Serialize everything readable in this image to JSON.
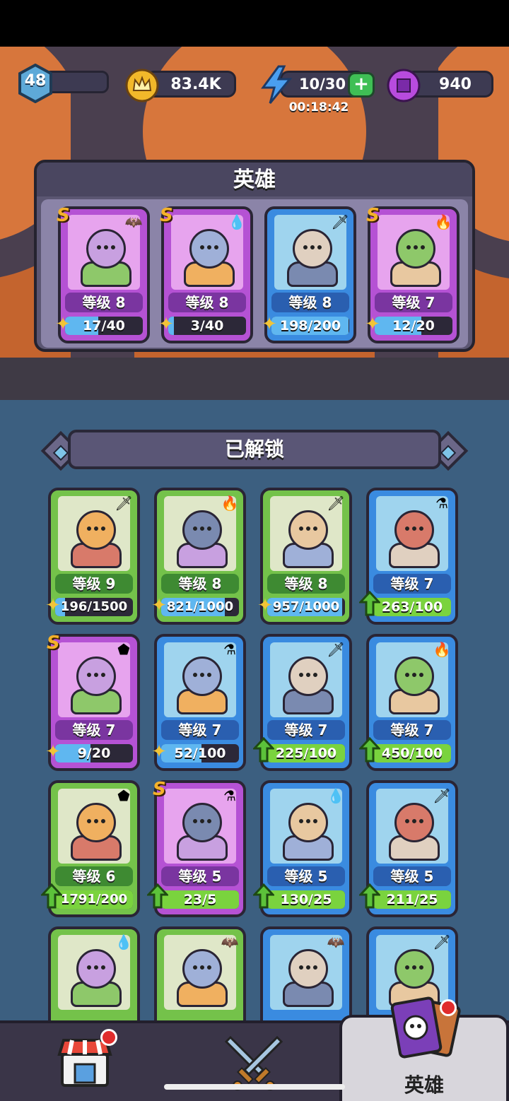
{
  "topbar": {
    "player_level": "48",
    "coins": "83.4K",
    "energy": "10/30",
    "energy_timer": "00:18:42",
    "gems": "940",
    "xp_progress": 0.07
  },
  "hero_panel": {
    "title": "英雄",
    "cards": [
      {
        "rank": "S",
        "element": "bat",
        "level": "等级 8",
        "progress": "17/40",
        "fraction": 0.425,
        "color": "purple",
        "bottom": "piece"
      },
      {
        "rank": "S",
        "element": "water",
        "level": "等级 8",
        "progress": "3/40",
        "fraction": 0.075,
        "color": "purple",
        "bottom": "piece"
      },
      {
        "rank": "",
        "element": "sword",
        "level": "等级 8",
        "progress": "198/200",
        "fraction": 0.99,
        "color": "blue",
        "bottom": "piece"
      },
      {
        "rank": "S",
        "element": "fire",
        "level": "等级 7",
        "progress": "12/20",
        "fraction": 0.6,
        "color": "purple",
        "bottom": "piece"
      }
    ]
  },
  "unlocked": {
    "title": "已解锁",
    "cards": [
      {
        "rank": "",
        "element": "sword",
        "level": "等级 9",
        "progress": "196/1500",
        "fraction": 0.13,
        "color": "green",
        "bottom": "piece"
      },
      {
        "rank": "",
        "element": "fire",
        "level": "等级 8",
        "progress": "821/1000",
        "fraction": 0.82,
        "color": "green",
        "bottom": "piece"
      },
      {
        "rank": "",
        "element": "sword",
        "level": "等级 8",
        "progress": "957/1000",
        "fraction": 0.96,
        "color": "green",
        "bottom": "piece"
      },
      {
        "rank": "",
        "element": "potion",
        "level": "等级 7",
        "progress": "263/100",
        "fraction": 1,
        "color": "blue",
        "bottom": "up"
      },
      {
        "rank": "S",
        "element": "rock",
        "level": "等级 7",
        "progress": "9/20",
        "fraction": 0.45,
        "color": "purple",
        "bottom": "piece"
      },
      {
        "rank": "",
        "element": "potion",
        "level": "等级 7",
        "progress": "52/100",
        "fraction": 0.52,
        "color": "blue",
        "bottom": "piece"
      },
      {
        "rank": "",
        "element": "sword",
        "level": "等级 7",
        "progress": "225/100",
        "fraction": 1,
        "color": "blue",
        "bottom": "up"
      },
      {
        "rank": "",
        "element": "fire",
        "level": "等级 7",
        "progress": "450/100",
        "fraction": 1,
        "color": "blue",
        "bottom": "up"
      },
      {
        "rank": "",
        "element": "rock",
        "level": "等级 6",
        "progress": "1791/200",
        "fraction": 1,
        "color": "green",
        "bottom": "up"
      },
      {
        "rank": "S",
        "element": "potion",
        "level": "等级 5",
        "progress": "23/5",
        "fraction": 1,
        "color": "purple",
        "bottom": "up"
      },
      {
        "rank": "",
        "element": "water",
        "level": "等级 5",
        "progress": "130/25",
        "fraction": 1,
        "color": "blue",
        "bottom": "up"
      },
      {
        "rank": "",
        "element": "sword",
        "level": "等级 5",
        "progress": "211/25",
        "fraction": 1,
        "color": "blue",
        "bottom": "up"
      },
      {
        "rank": "",
        "element": "water",
        "level": "",
        "progress": "",
        "fraction": 0,
        "color": "green",
        "bottom": ""
      },
      {
        "rank": "",
        "element": "bat",
        "level": "",
        "progress": "",
        "fraction": 0,
        "color": "green",
        "bottom": ""
      },
      {
        "rank": "",
        "element": "bat",
        "level": "",
        "progress": "",
        "fraction": 0,
        "color": "blue",
        "bottom": ""
      },
      {
        "rank": "",
        "element": "sword",
        "level": "",
        "progress": "",
        "fraction": 0,
        "color": "blue",
        "bottom": ""
      }
    ]
  },
  "bottomnav": {
    "hero_label": "英雄"
  },
  "colors": {
    "accent_gold": "#f4b22a",
    "progress_blue": "#5fb7f0",
    "progress_green": "#7ad33e"
  }
}
